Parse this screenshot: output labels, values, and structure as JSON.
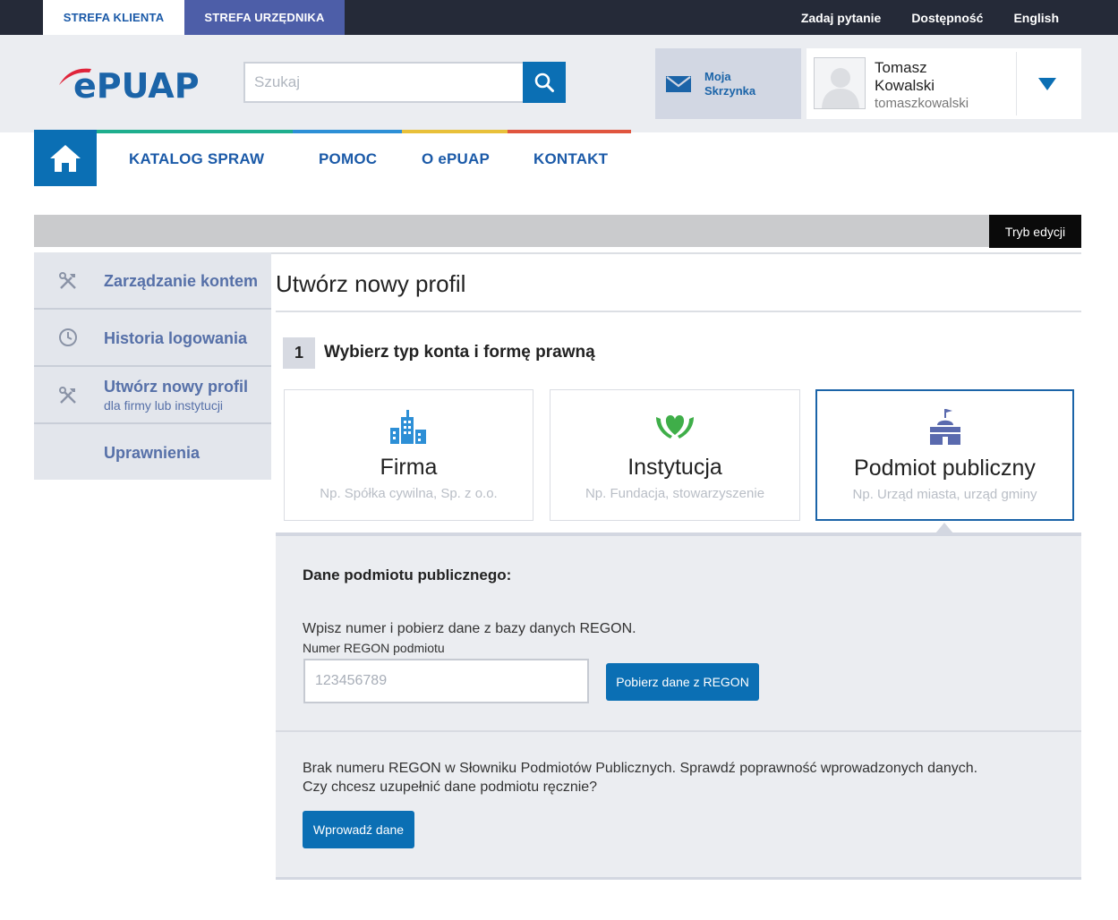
{
  "topbar": {
    "zone_client": "STREFA KLIENTA",
    "zone_official": "STREFA URZĘDNIKA",
    "links": [
      "Zadaj pytanie",
      "Dostępność",
      "English"
    ]
  },
  "header": {
    "logo_text": "ePUAP",
    "search_placeholder": "Szukaj",
    "mailbox_line1": "Moja",
    "mailbox_line2": "Skrzynka",
    "user_first": "Tomasz",
    "user_last": "Kowalski",
    "user_login": "tomaszkowalski"
  },
  "nav": {
    "items": [
      "KATALOG SPRAW",
      "POMOC",
      "O ePUAP",
      "KONTAKT"
    ]
  },
  "edit_mode_label": "Tryb edycji",
  "sidebar": {
    "items": [
      {
        "label": "Zarządzanie kontem",
        "sub": ""
      },
      {
        "label": "Historia logowania",
        "sub": ""
      },
      {
        "label": "Utwórz nowy profil",
        "sub": "dla firmy lub instytucji"
      },
      {
        "label": "Uprawnienia",
        "sub": ""
      }
    ]
  },
  "main": {
    "title": "Utwórz nowy profil",
    "step_number": "1",
    "step_title": "Wybierz typ konta i formę prawną",
    "cards": [
      {
        "title": "Firma",
        "sub": "Np. Spółka cywilna, Sp. z o.o."
      },
      {
        "title": "Instytucja",
        "sub": "Np. Fundacja, stowarzyszenie"
      },
      {
        "title": "Podmiot publiczny",
        "sub": "Np. Urząd miasta, urząd gminy"
      }
    ]
  },
  "form": {
    "heading": "Dane podmiotu publicznego:",
    "instruction": "Wpisz numer i pobierz dane z bazy danych REGON.",
    "field_label": "Numer REGON podmiotu",
    "field_placeholder": "123456789",
    "fetch_button": "Pobierz dane z REGON",
    "missing_line1": "Brak numeru REGON w Słowniku Podmiotów Publicznych. Sprawdź poprawność wprowadzonych danych.",
    "missing_line2": "Czy chcesz uzupełnić dane podmiotu ręcznie?",
    "enter_button": "Wprowadź dane"
  },
  "colors": {
    "primary": "#0b6fb4",
    "topbar": "#252a38",
    "official_tab": "#4d5ea8",
    "strip": [
      "#1fae8e",
      "#2d8fd6",
      "#e8c03a",
      "#e0553e"
    ]
  }
}
